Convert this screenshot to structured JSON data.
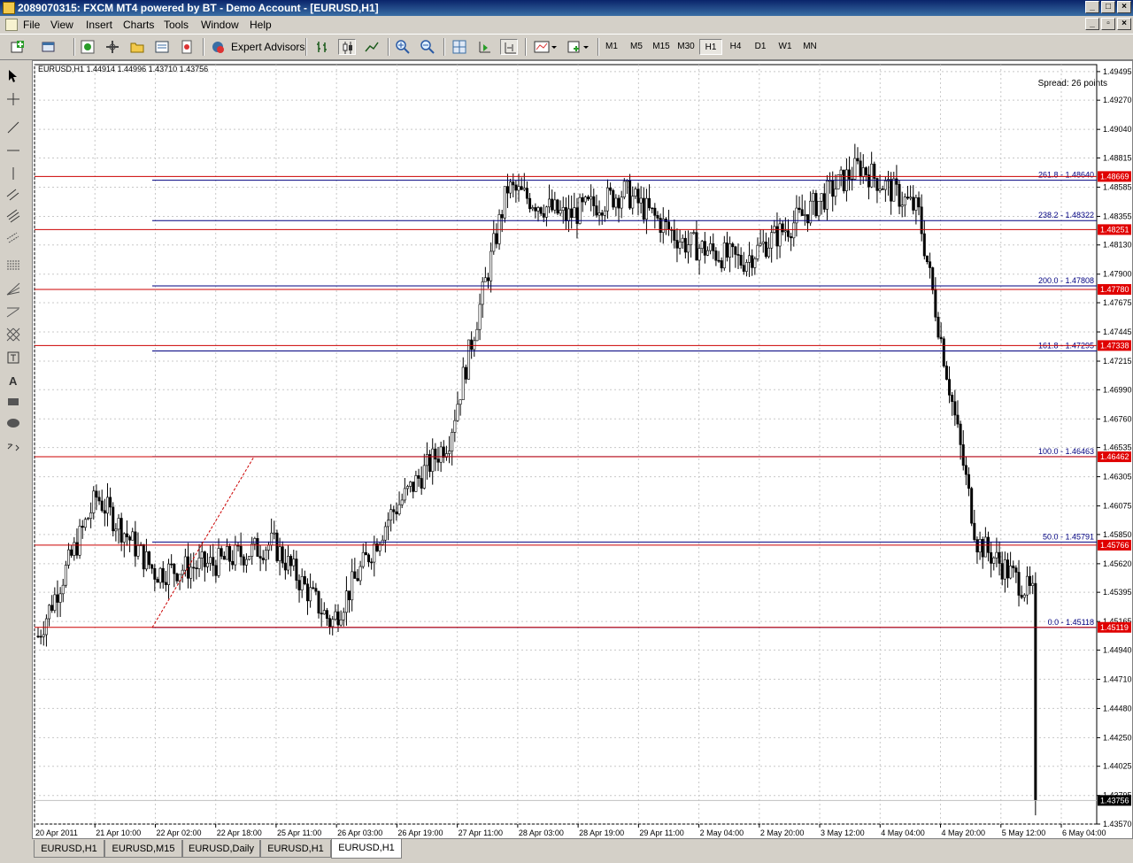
{
  "window": {
    "title": "2089070315: FXCM MT4 powered by BT - Demo Account - [EURUSD,H1]"
  },
  "menu": [
    "File",
    "View",
    "Insert",
    "Charts",
    "Tools",
    "Window",
    "Help"
  ],
  "toolbar": {
    "expert_advisors": "Expert Advisors",
    "timeframes": [
      "M1",
      "M5",
      "M15",
      "M30",
      "H1",
      "H4",
      "D1",
      "W1",
      "MN"
    ],
    "active_timeframe": "H1"
  },
  "chart": {
    "header": "EURUSD,H1  1.44914 1.44996 1.43710 1.43756",
    "spread": "Spread: 26 points",
    "price_axis": [
      "1.49495",
      "1.49270",
      "1.49040",
      "1.48815",
      "1.48585",
      "1.48355",
      "1.48130",
      "1.47900",
      "1.47675",
      "1.47445",
      "1.47215",
      "1.46990",
      "1.46760",
      "1.46535",
      "1.46305",
      "1.46075",
      "1.45850",
      "1.45620",
      "1.45395",
      "1.45165",
      "1.44940",
      "1.44710",
      "1.44480",
      "1.44250",
      "1.44025",
      "1.43795",
      "1.43570"
    ],
    "time_axis": [
      "20 Apr 2011",
      "21 Apr 10:00",
      "22 Apr 02:00",
      "22 Apr 18:00",
      "25 Apr 11:00",
      "26 Apr 03:00",
      "26 Apr 19:00",
      "27 Apr 11:00",
      "28 Apr 03:00",
      "28 Apr 19:00",
      "29 Apr 11:00",
      "2 May 04:00",
      "2 May 20:00",
      "3 May 12:00",
      "4 May 04:00",
      "4 May 20:00",
      "5 May 12:00",
      "6 May 04:00"
    ],
    "current_price": "1.43756",
    "fib_levels": [
      {
        "label": "261.8 - 1.48640",
        "price": 1.4864
      },
      {
        "label": "238.2 - 1.48322",
        "price": 1.48322
      },
      {
        "label": "200.0 - 1.47808",
        "price": 1.47808
      },
      {
        "label": "161.8 - 1.47295",
        "price": 1.47295
      },
      {
        "label": "100.0 - 1.46463",
        "price": 1.46463
      },
      {
        "label": "50.0 - 1.45791",
        "price": 1.45791
      },
      {
        "label": "0.0 - 1.45118",
        "price": 1.45118
      }
    ],
    "red_levels": [
      {
        "label": "1.48669",
        "price": 1.48669
      },
      {
        "label": "1.48251",
        "price": 1.48251
      },
      {
        "label": "1.47780",
        "price": 1.4778
      },
      {
        "label": "1.47338",
        "price": 1.47338
      },
      {
        "label": "1.46462",
        "price": 1.46462
      },
      {
        "label": "1.45766",
        "price": 1.45766
      },
      {
        "label": "1.45119",
        "price": 1.45119
      }
    ],
    "colors": {
      "fib": "#000080",
      "red_line": "#cc0000",
      "label_bg": "#e00000",
      "candle": "#000000"
    }
  },
  "chart_data": {
    "type": "line",
    "title": "EURUSD,H1",
    "x": [
      "20 Apr 2011",
      "21 Apr 10:00",
      "22 Apr 02:00",
      "22 Apr 18:00",
      "25 Apr 11:00",
      "26 Apr 03:00",
      "26 Apr 19:00",
      "27 Apr 11:00",
      "28 Apr 03:00",
      "28 Apr 19:00",
      "29 Apr 11:00",
      "2 May 04:00",
      "2 May 20:00",
      "3 May 12:00",
      "4 May 04:00",
      "4 May 20:00",
      "5 May 12:00",
      "6 May 04:00"
    ],
    "y": [
      1.4505,
      1.4615,
      1.4555,
      1.4562,
      1.4578,
      1.4515,
      1.46,
      1.466,
      1.4858,
      1.4835,
      1.4855,
      1.4815,
      1.48,
      1.4835,
      1.4875,
      1.484,
      1.458,
      1.4535
    ],
    "ylim": [
      1.4357,
      1.4955
    ],
    "last_close": 1.43756,
    "grid": true
  },
  "tabs": [
    "EURUSD,H1",
    "EURUSD,M15",
    "EURUSD,Daily",
    "EURUSD,H1",
    "EURUSD,H1"
  ],
  "active_tab": 4
}
